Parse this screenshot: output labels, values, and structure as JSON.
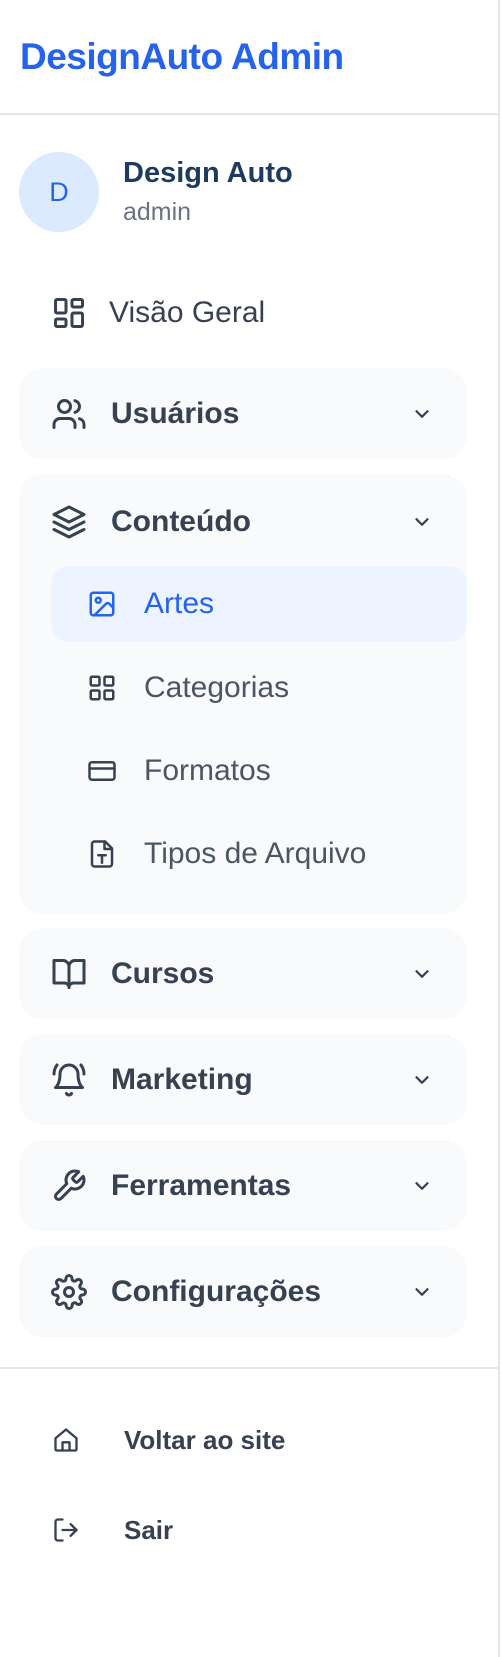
{
  "brand": {
    "title": "DesignAuto Admin"
  },
  "user": {
    "initial": "D",
    "name": "Design Auto",
    "role": "admin"
  },
  "nav": {
    "overview": {
      "label": "Visão Geral",
      "icon": "grid-icon"
    },
    "groups": [
      {
        "label": "Usuários",
        "icon": "users-icon"
      },
      {
        "label": "Conteúdo",
        "icon": "layers-icon",
        "items": [
          {
            "label": "Artes",
            "icon": "image-icon",
            "active": true
          },
          {
            "label": "Categorias",
            "icon": "grid-icon"
          },
          {
            "label": "Formatos",
            "icon": "card-icon"
          },
          {
            "label": "Tipos de Arquivo",
            "icon": "file-type-icon"
          }
        ]
      },
      {
        "label": "Cursos",
        "icon": "book-icon"
      },
      {
        "label": "Marketing",
        "icon": "bell-ring-icon"
      },
      {
        "label": "Ferramentas",
        "icon": "wrench-icon"
      },
      {
        "label": "Configurações",
        "icon": "gear-icon"
      }
    ]
  },
  "footer": {
    "back": {
      "label": "Voltar ao site",
      "icon": "home-icon"
    },
    "logout": {
      "label": "Sair",
      "icon": "logout-icon"
    }
  },
  "colors": {
    "accent": "#2563eb",
    "group_bg": "#f8fafc",
    "active_bg": "#eef4ff",
    "avatar_bg": "#dbeafe"
  }
}
